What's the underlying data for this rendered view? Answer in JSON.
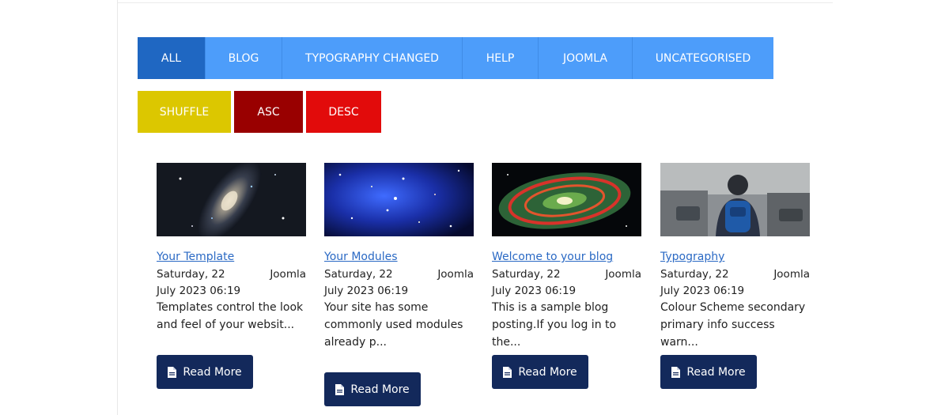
{
  "filters": {
    "all": "ALL",
    "blog": "BLOG",
    "typography": "TYPOGRAPHY CHANGED",
    "help": "HELP",
    "joomla": "JOOMLA",
    "uncategorised": "UNCATEGORISED"
  },
  "sort": {
    "shuffle": "SHUFFLE",
    "asc": "ASC",
    "desc": "DESC"
  },
  "colors": {
    "filter_bg": "#4d9dfa",
    "filter_active_bg": "#1f67c2",
    "shuffle_bg": "#dcc700",
    "asc_bg": "#990000",
    "desc_bg": "#e20b0b",
    "button_bg": "#13295b",
    "link": "#2a69c4"
  },
  "articles": [
    {
      "title": "Your Template",
      "date": "Saturday, 22 July 2023 06:19",
      "category": "Joomla",
      "intro": "Templates control the look and feel of your websit...",
      "read_more": "Read More",
      "image": "spiral-galaxy"
    },
    {
      "title": "Your Modules",
      "date": "Saturday, 22 July 2023 06:19",
      "category": "Joomla",
      "intro": "Your site has some commonly used modules already p...",
      "read_more": "Read More",
      "image": "blue-star-field"
    },
    {
      "title": "Welcome to your blog",
      "date": "Saturday, 22 July 2023 06:19",
      "category": "Joomla",
      "intro": "This is a sample blog posting.If you log in to the...",
      "read_more": "Read More",
      "image": "infrared-galaxy"
    },
    {
      "title": "Typography",
      "date": "Saturday, 22 July 2023 06:19",
      "category": "Joomla",
      "intro": "Colour Scheme secondary primary info success warn...",
      "read_more": "Read More",
      "image": "man-with-backpack"
    }
  ]
}
